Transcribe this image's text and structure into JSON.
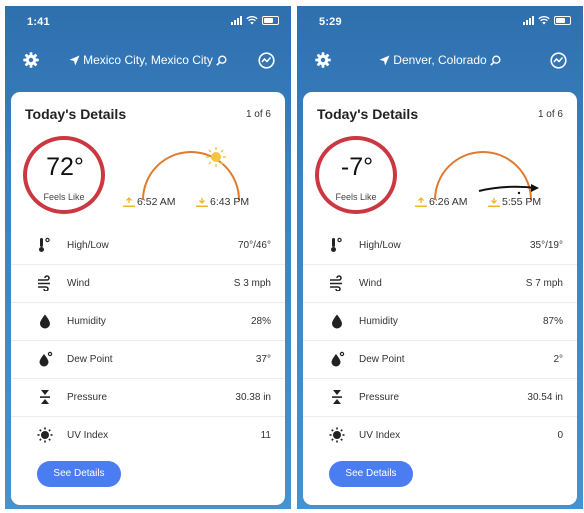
{
  "screens": [
    {
      "status_time": "1:41",
      "location": "Mexico City, Mexico City",
      "card_title": "Today's Details",
      "page_indicator": "1 of 6",
      "temperature": "72°",
      "feels_like_label": "Feels Like",
      "sunrise": "6:52 AM",
      "sunset": "6:43 PM",
      "rows": [
        {
          "icon": "thermometer-icon",
          "label": "High/Low",
          "value": "70°/46°"
        },
        {
          "icon": "wind-icon",
          "label": "Wind",
          "value": "S 3 mph"
        },
        {
          "icon": "humidity-drop-icon",
          "label": "Humidity",
          "value": "28%"
        },
        {
          "icon": "dew-point-icon",
          "label": "Dew Point",
          "value": "37°"
        },
        {
          "icon": "pressure-icon",
          "label": "Pressure",
          "value": "30.38 in"
        },
        {
          "icon": "uv-sun-icon",
          "label": "UV Index",
          "value": "11"
        }
      ],
      "button_label": "See Details"
    },
    {
      "status_time": "5:29",
      "location": "Denver, Colorado",
      "card_title": "Today's Details",
      "page_indicator": "1 of 6",
      "temperature": "-7°",
      "feels_like_label": "Feels Like",
      "sunrise": "6:26 AM",
      "sunset": "5:55 PM",
      "rows": [
        {
          "icon": "thermometer-icon",
          "label": "High/Low",
          "value": "35°/19°"
        },
        {
          "icon": "wind-icon",
          "label": "Wind",
          "value": "S 7 mph"
        },
        {
          "icon": "humidity-drop-icon",
          "label": "Humidity",
          "value": "87%"
        },
        {
          "icon": "dew-point-icon",
          "label": "Dew Point",
          "value": "2°"
        },
        {
          "icon": "pressure-icon",
          "label": "Pressure",
          "value": "30.54 in"
        },
        {
          "icon": "uv-sun-icon",
          "label": "UV Index",
          "value": "0"
        }
      ],
      "button_label": "See Details"
    }
  ],
  "colors": {
    "background_top": "#2f6fae",
    "background_bottom": "#4592cf",
    "highlight_ring": "#cc3842",
    "sun_arc": "#e07a2e",
    "button": "#4a7cf2"
  }
}
